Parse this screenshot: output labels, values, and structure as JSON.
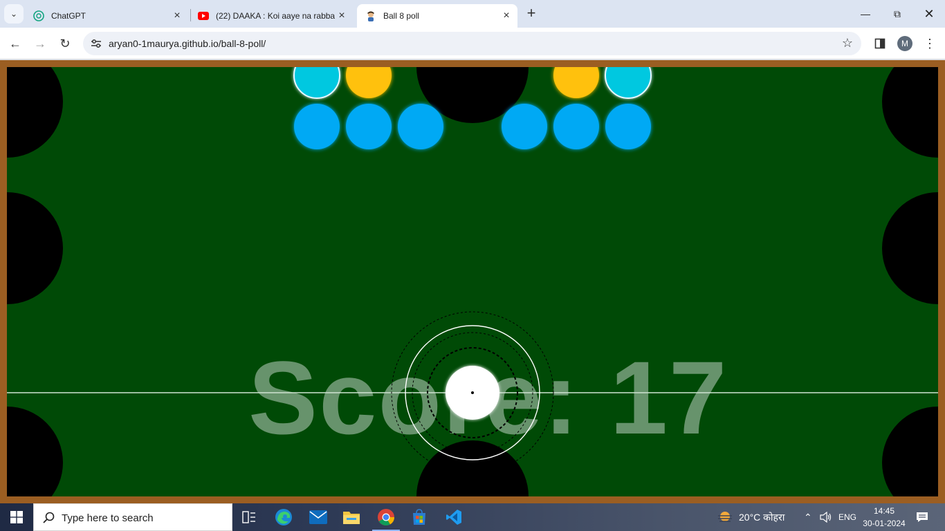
{
  "browser": {
    "tabs": [
      {
        "title": "ChatGPT",
        "icon": "chatgpt-icon"
      },
      {
        "title": "(22) DAAKA : Koi aaye na rabba",
        "icon": "youtube-icon"
      },
      {
        "title": "Ball 8 poll",
        "icon": "avatar-icon"
      }
    ],
    "url": "aryan0-1maurya.github.io/ball-8-poll/",
    "profile_initial": "M"
  },
  "game": {
    "score_label": "Score: 17",
    "colors": {
      "rail": "#9b5e22",
      "felt": "#004a06",
      "pocket": "#000000",
      "ball_blue": "#03a9f4",
      "ball_cyan": "#00c8e0",
      "ball_yellow": "#ffc107",
      "cue_ball": "#ffffff"
    }
  },
  "taskbar": {
    "search_placeholder": "Type here to search",
    "weather": "20°C कोहरा",
    "language": "ENG",
    "time": "14:45",
    "date": "30-01-2024"
  }
}
